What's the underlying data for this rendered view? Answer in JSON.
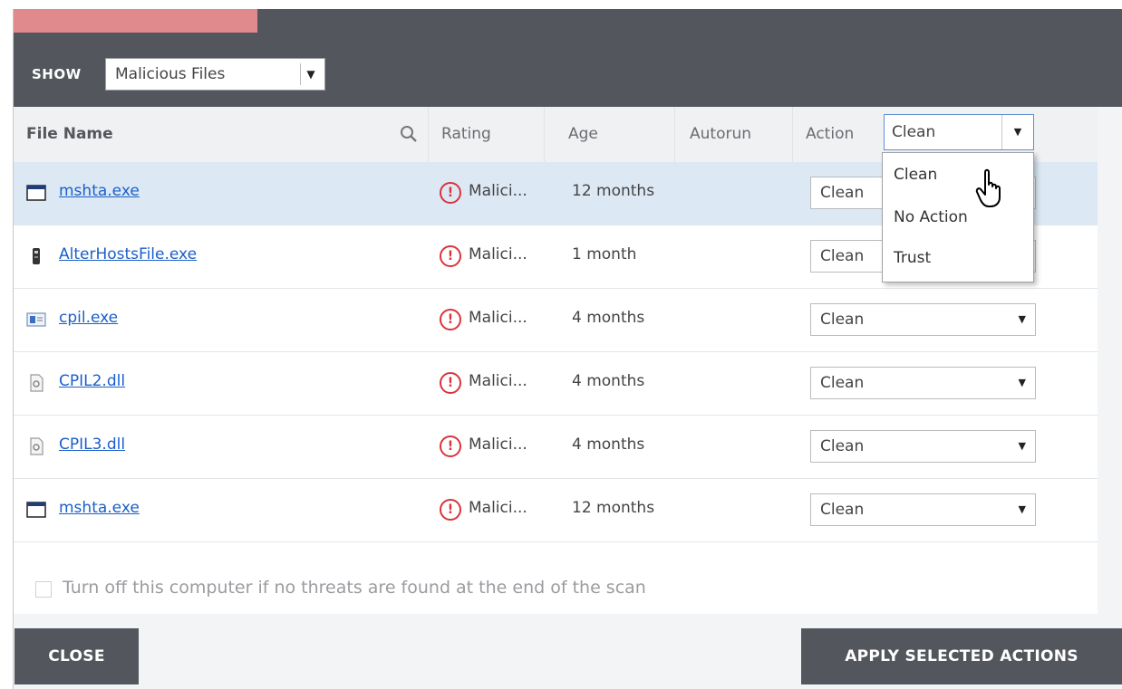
{
  "scan": {
    "progress_fraction": 0.22
  },
  "show_filter": {
    "label": "SHOW",
    "selected": "Malicious Files"
  },
  "columns": {
    "file_name": "File Name",
    "rating": "Rating",
    "age": "Age",
    "autorun": "Autorun",
    "action": "Action",
    "action_bulk_value": "Clean"
  },
  "rows": [
    {
      "file": "mshta.exe",
      "icon": "window-icon",
      "rating": "Malici...",
      "age": "12 months",
      "action": "Clean"
    },
    {
      "file": "AlterHostsFile.exe",
      "icon": "app-icon",
      "rating": "Malici...",
      "age": "1 month",
      "action": "Clean"
    },
    {
      "file": "cpil.exe",
      "icon": "window-icon",
      "rating": "Malici...",
      "age": "4 months",
      "action": "Clean"
    },
    {
      "file": "CPIL2.dll",
      "icon": "dll-file-icon",
      "rating": "Malici...",
      "age": "4 months",
      "action": "Clean"
    },
    {
      "file": "CPIL3.dll",
      "icon": "dll-file-icon",
      "rating": "Malici...",
      "age": "4 months",
      "action": "Clean"
    },
    {
      "file": "mshta.exe",
      "icon": "window-icon",
      "rating": "Malici...",
      "age": "12 months",
      "action": "Clean"
    }
  ],
  "action_dropdown": {
    "options": [
      "Clean",
      "No Action",
      "Trust"
    ]
  },
  "shutdown_option": {
    "label": "Turn off this computer if no threats are found at the end of the scan",
    "checked": false
  },
  "buttons": {
    "close": "CLOSE",
    "apply": "APPLY SELECTED ACTIONS"
  },
  "colors": {
    "toolbar": "#53565d",
    "progress": "#e08a8e",
    "selected_row": "#dce9f5",
    "link": "#1b5fc9",
    "warning": "#d9343a"
  }
}
